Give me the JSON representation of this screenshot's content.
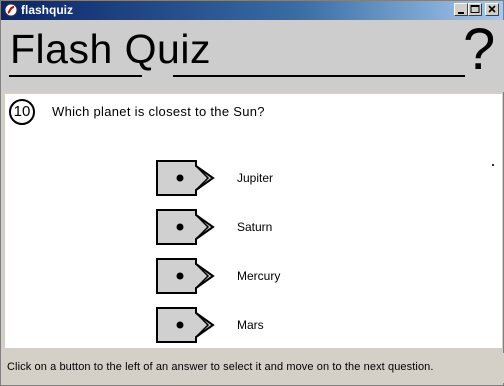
{
  "window": {
    "title": "flashquiz",
    "buttons": {
      "minimize": "minimize",
      "maximize": "maximize",
      "close": "close"
    }
  },
  "header": {
    "title": "Flash Quiz",
    "help_symbol": "?"
  },
  "question": {
    "number": "10",
    "text": "Which planet is closest to the Sun?"
  },
  "answers": [
    {
      "label": "Jupiter",
      "icon": "arrow-button-icon"
    },
    {
      "label": "Saturn",
      "icon": "arrow-button-icon"
    },
    {
      "label": "Mercury",
      "icon": "arrow-button-icon"
    },
    {
      "label": "Mars",
      "icon": "arrow-button-icon"
    }
  ],
  "status": {
    "text": "Click on a button to the left of an answer to select it and move on to the next question."
  },
  "colors": {
    "titlebar_start": "#0a246a",
    "titlebar_end": "#a6caf0",
    "header_bg": "#cdcdcd",
    "panel_bg": "#ffffff",
    "button_fill": "#d0d0d0"
  }
}
